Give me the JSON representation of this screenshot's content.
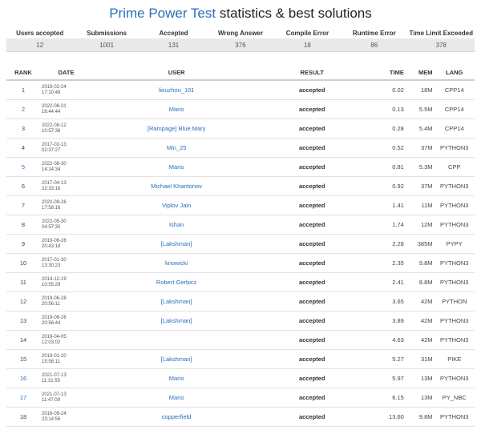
{
  "page": {
    "title_link": "Prime Power Test",
    "title_rest": " statistics & best solutions"
  },
  "stats": {
    "headers": [
      "Users accepted",
      "Submissions",
      "Accepted",
      "Wrong Answer",
      "Compile Error",
      "Runtime Error",
      "Time Limit Exceeded"
    ],
    "values": [
      "12",
      "1001",
      "131",
      "376",
      "18",
      "86",
      "378"
    ]
  },
  "ranking": {
    "headers": {
      "rank": "RANK",
      "date": "DATE",
      "user": "USER",
      "result": "RESULT",
      "time": "TIME",
      "mem": "MEM",
      "lang": "LANG"
    },
    "rows": [
      {
        "rank": "1",
        "rank_link": false,
        "date": "2019-02-24\n17:10:48",
        "user": "liouzhou_101",
        "result": "accepted",
        "time": "0.02",
        "mem": "18M",
        "lang": "CPP14"
      },
      {
        "rank": "2",
        "rank_link": true,
        "date": "2022-08-31\n16:44:44",
        "user": "Mario",
        "result": "accepted",
        "time": "0.13",
        "mem": "5.5M",
        "lang": "CPP14"
      },
      {
        "rank": "3",
        "rank_link": false,
        "date": "2022-08-12\n10:57:36",
        "user": "[Rampage] Blue.Mary",
        "result": "accepted",
        "time": "0.28",
        "mem": "5.4M",
        "lang": "CPP14"
      },
      {
        "rank": "4",
        "rank_link": false,
        "date": "2017-02-13\n02:37:27",
        "user": "Min_25",
        "result": "accepted",
        "time": "0.52",
        "mem": "37M",
        "lang": "PYTHON3"
      },
      {
        "rank": "5",
        "rank_link": true,
        "date": "2022-08-30\n14:14:34",
        "user": "Mario",
        "result": "accepted",
        "time": "0.81",
        "mem": "5.3M",
        "lang": "CPP"
      },
      {
        "rank": "6",
        "rank_link": false,
        "date": "2017-04-13\n22:33:16",
        "user": "Michael Kharitonov",
        "result": "accepted",
        "time": "0.92",
        "mem": "37M",
        "lang": "PYTHON3"
      },
      {
        "rank": "7",
        "rank_link": false,
        "date": "2020-09-26\n17:58:16",
        "user": "Viplov Jain",
        "result": "accepted",
        "time": "1.41",
        "mem": "11M",
        "lang": "PYTHON3"
      },
      {
        "rank": "8",
        "rank_link": false,
        "date": "2022-05-30\n04:57:30",
        "user": "Ishan",
        "result": "accepted",
        "time": "1.74",
        "mem": "12M",
        "lang": "PYTHON3"
      },
      {
        "rank": "9",
        "rank_link": false,
        "date": "2019-06-26\n20:43:18",
        "user": "[Lakshman]",
        "result": "accepted",
        "time": "2.28",
        "mem": "385M",
        "lang": "PYPY"
      },
      {
        "rank": "10",
        "rank_link": false,
        "date": "2017-01-30\n13:30:23",
        "user": "knowicki",
        "result": "accepted",
        "time": "2.35",
        "mem": "9.8M",
        "lang": "PYTHON3"
      },
      {
        "rank": "11",
        "rank_link": false,
        "date": "2014-12-19\n10:55:29",
        "user": "Robert Gerbicz",
        "result": "accepted",
        "time": "2.41",
        "mem": "8.8M",
        "lang": "PYTHON3"
      },
      {
        "rank": "12",
        "rank_link": false,
        "date": "2019-06-26\n20:56:11",
        "user": "[Lakshman]",
        "result": "accepted",
        "time": "3.65",
        "mem": "42M",
        "lang": "PYTHON"
      },
      {
        "rank": "13",
        "rank_link": false,
        "date": "2019-06-26\n20:56:44",
        "user": "[Lakshman]",
        "result": "accepted",
        "time": "3.89",
        "mem": "42M",
        "lang": "PYTHON3"
      },
      {
        "rank": "14",
        "rank_link": false,
        "date": "2019-04-05\n12:03:02",
        "user": "",
        "result": "accepted",
        "time": "4.63",
        "mem": "42M",
        "lang": "PYTHON3"
      },
      {
        "rank": "15",
        "rank_link": false,
        "date": "2019-01-20\n15:58:11",
        "user": "[Lakshman]",
        "result": "accepted",
        "time": "5.27",
        "mem": "31M",
        "lang": "PIKE"
      },
      {
        "rank": "16",
        "rank_link": true,
        "date": "2021-07-13\n11:31:55",
        "user": "Mario",
        "result": "accepted",
        "time": "5.97",
        "mem": "13M",
        "lang": "PYTHON3"
      },
      {
        "rank": "17",
        "rank_link": true,
        "date": "2021-07-13\n11:47:09",
        "user": "Mario",
        "result": "accepted",
        "time": "6.15",
        "mem": "13M",
        "lang": "PY_NBC"
      },
      {
        "rank": "18",
        "rank_link": false,
        "date": "2016-09-24\n23:14:56",
        "user": "copperfield",
        "result": "accepted",
        "time": "13.60",
        "mem": "9.8M",
        "lang": "PYTHON3"
      }
    ]
  }
}
